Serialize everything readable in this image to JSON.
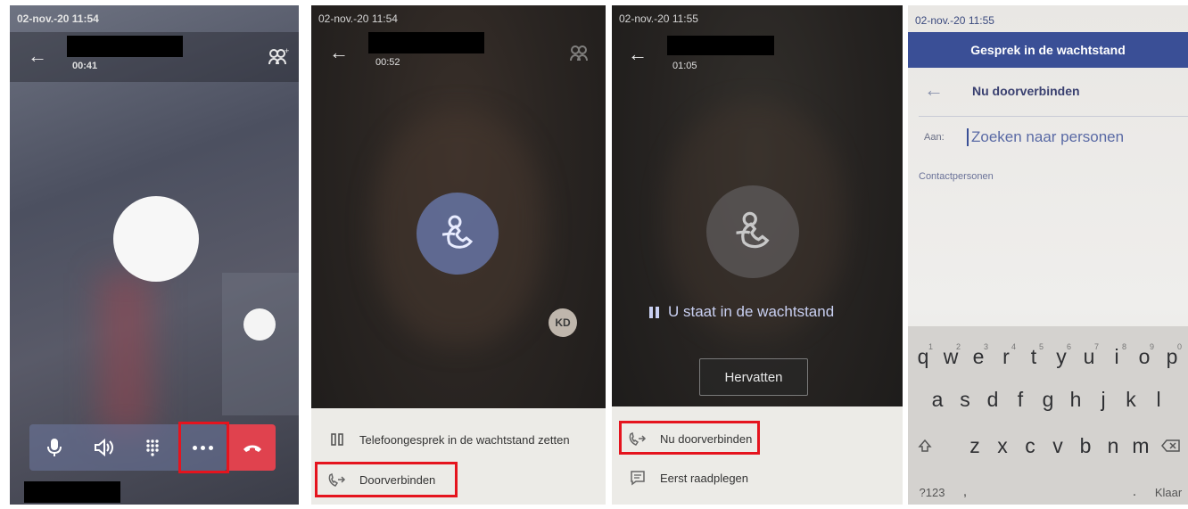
{
  "screens": [
    {
      "status_time": "02-nov.-20  11:54",
      "call_timer": "00:41",
      "controls": [
        {
          "icon": "microphone-icon"
        },
        {
          "icon": "speaker-icon"
        },
        {
          "icon": "dialpad-icon"
        },
        {
          "icon": "more-options-icon"
        },
        {
          "icon": "hang-up-icon"
        }
      ],
      "highlight_color": "#e5141e",
      "hangup_color": "#e0424e"
    },
    {
      "status_time": "02-nov.-20  11:54",
      "call_timer": "00:52",
      "participant_initials": "KD",
      "menu": [
        {
          "label": "Telefoongesprek in de wachtstand zetten",
          "icon": "pause-icon"
        },
        {
          "label": "Doorverbinden",
          "icon": "transfer-icon"
        }
      ]
    },
    {
      "status_time": "02-nov.-20  11:55",
      "call_timer": "01:05",
      "hold_status": "U staat in de wachtstand",
      "resume_label": "Hervatten",
      "menu": [
        {
          "label": "Nu doorverbinden",
          "icon": "transfer-icon"
        },
        {
          "label": "Eerst raadplegen",
          "icon": "consult-icon"
        }
      ]
    },
    {
      "status_time": "02-nov.-20  11:55",
      "title": "Gesprek in de wachtstand",
      "header": "Nu doorverbinden",
      "to_label": "Aan:",
      "search_placeholder": "Zoeken naar personen",
      "section_label": "Contactpersonen",
      "title_color": "#3a4f96",
      "keyboard": {
        "row1": [
          "q",
          "w",
          "e",
          "r",
          "t",
          "y",
          "u",
          "i",
          "o",
          "p"
        ],
        "row1_hints": [
          "1",
          "2",
          "3",
          "4",
          "5",
          "6",
          "7",
          "8",
          "9",
          "0"
        ],
        "row2": [
          "a",
          "s",
          "d",
          "f",
          "g",
          "h",
          "j",
          "k",
          "l"
        ],
        "row3": [
          "z",
          "x",
          "c",
          "v",
          "b",
          "n",
          "m"
        ],
        "numeric_key": "?123",
        "comma_key": ",",
        "period_key": ".",
        "enter_key": "Klaar"
      }
    }
  ]
}
